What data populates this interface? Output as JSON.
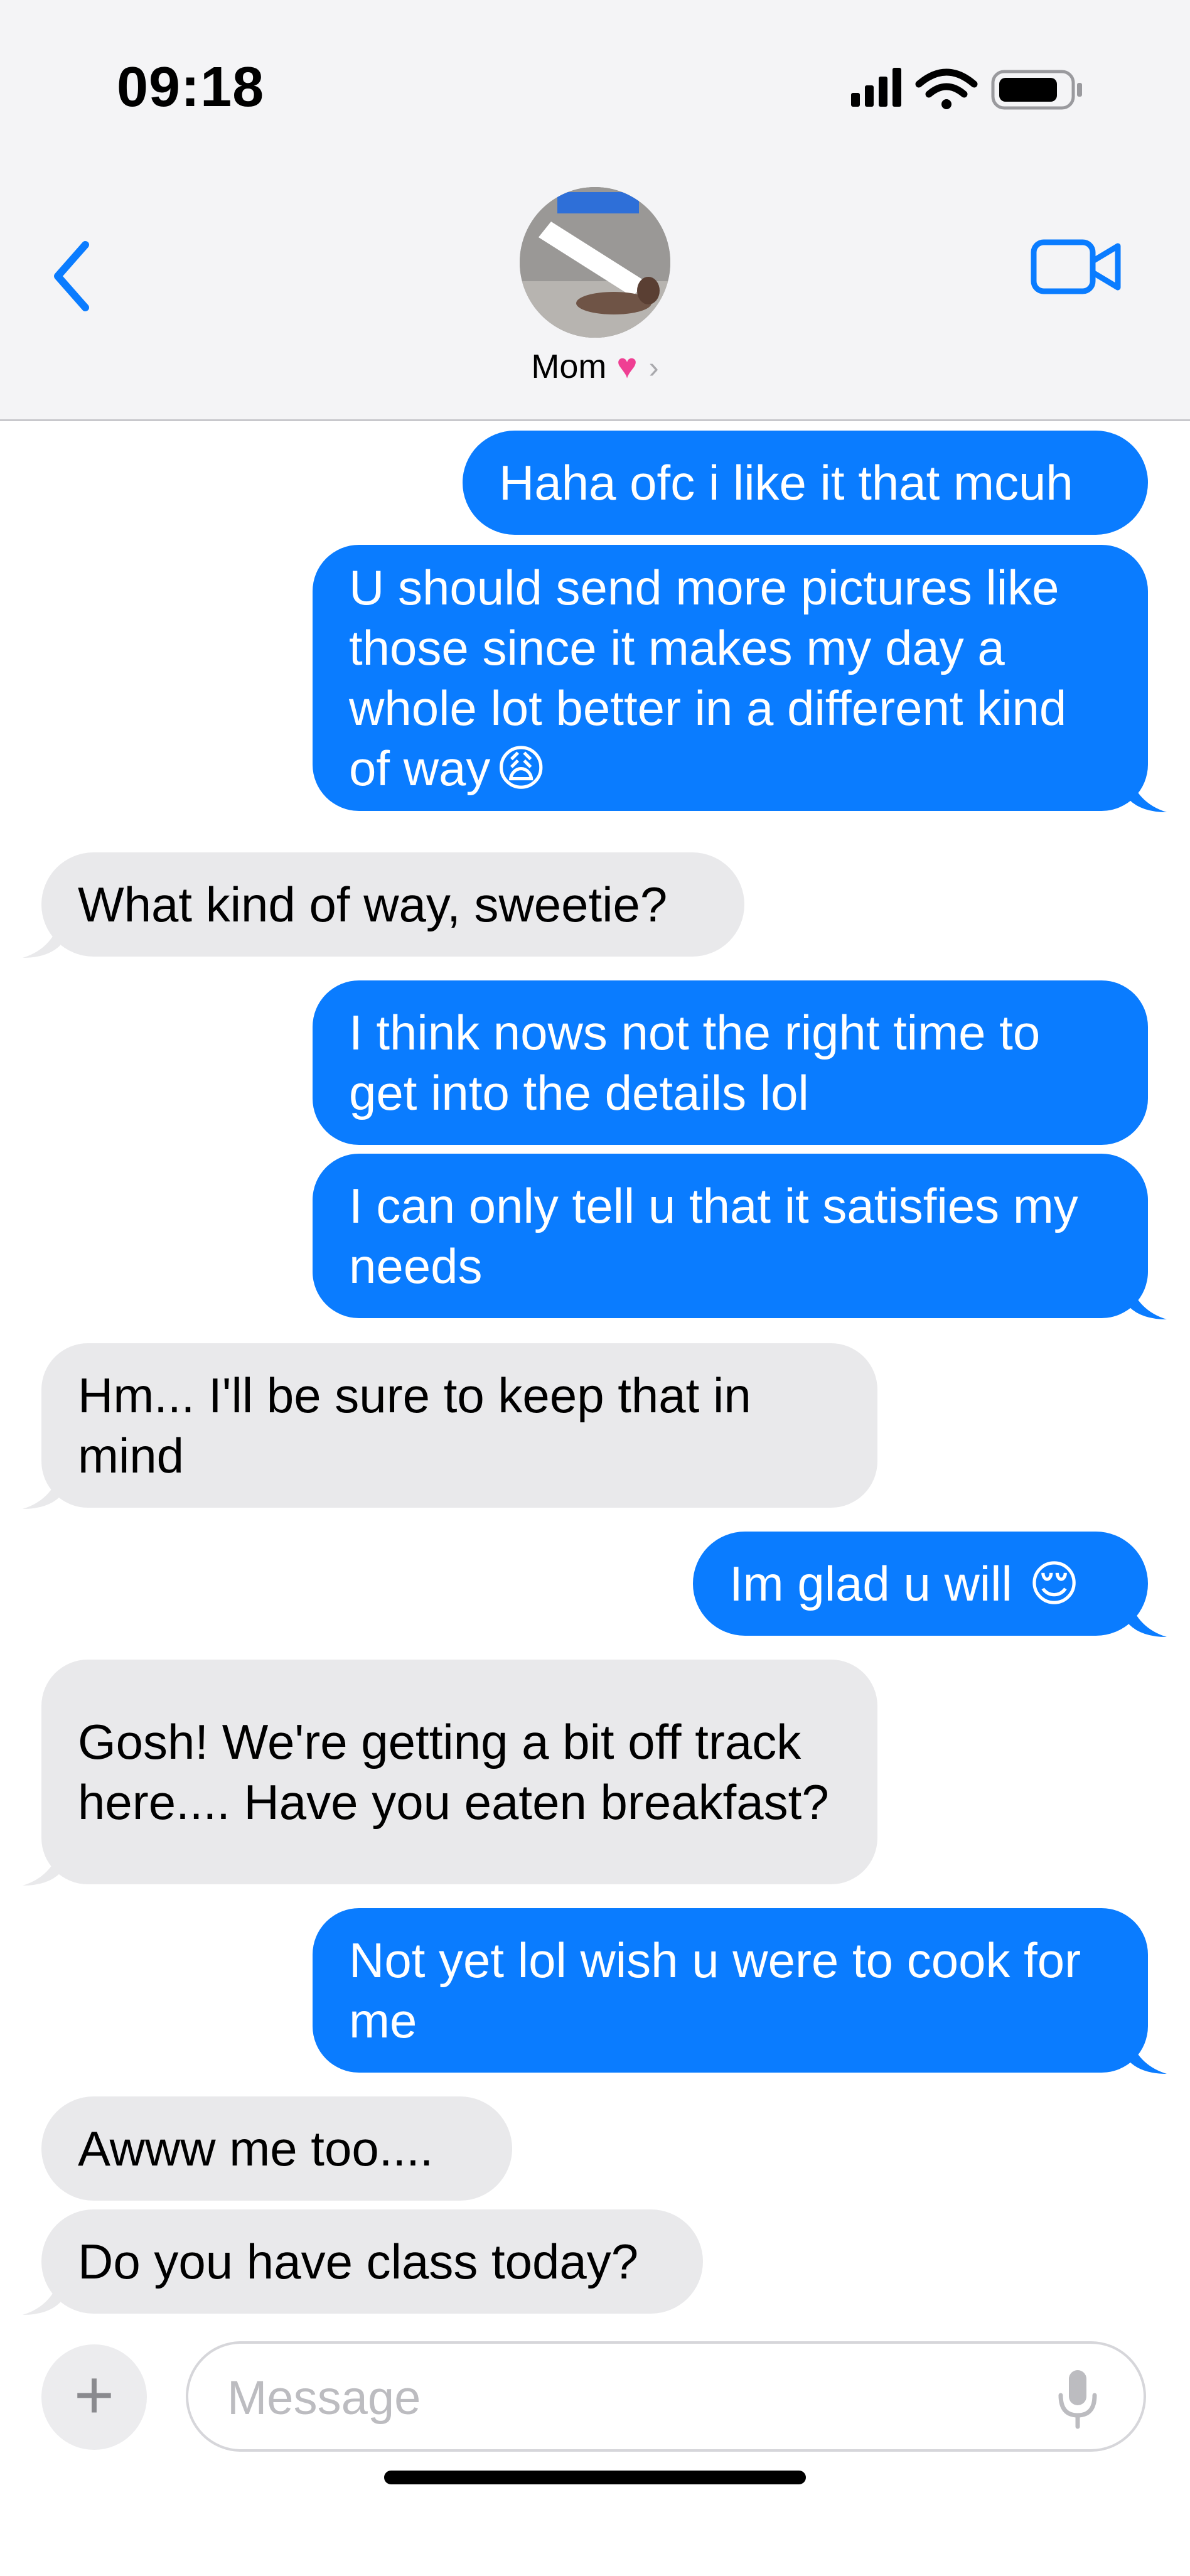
{
  "status_bar": {
    "time": "09:18"
  },
  "header": {
    "contact_name": "Mom",
    "heart": "♥",
    "chevron": "›"
  },
  "messages": [
    {
      "side": "out",
      "text": "Haha ofc i like it that mcuh"
    },
    {
      "side": "out",
      "text": "U should send more pictures like those since it makes my day a whole lot better in a different kind of way",
      "emoji": "😩"
    },
    {
      "side": "in",
      "text": "What kind of way, sweetie?"
    },
    {
      "side": "out",
      "text": "I think nows not the right time to get into the details lol"
    },
    {
      "side": "out",
      "text": "I can only tell u that it satisfies my needs"
    },
    {
      "side": "in",
      "text": "Hm... I'll be sure to keep that in mind"
    },
    {
      "side": "out",
      "text": "Im glad u will",
      "emoji": "😌"
    },
    {
      "side": "in",
      "text": "Gosh! We're getting a bit off track here.... Have you eaten breakfast?"
    },
    {
      "side": "out",
      "text": "Not yet lol wish u were to cook for me"
    },
    {
      "side": "in",
      "text": "Awww me too...."
    },
    {
      "side": "in",
      "text": "Do you have class today?"
    }
  ],
  "composer": {
    "plus": "+",
    "placeholder": "Message"
  },
  "colors": {
    "outgoing": "#0a7cff",
    "incoming": "#e9e9eb",
    "accent": "#0a7cff"
  },
  "icons": [
    "signal-icon",
    "wifi-icon",
    "battery-icon",
    "back-chevron-icon",
    "video-call-icon",
    "plus-icon",
    "microphone-icon"
  ]
}
